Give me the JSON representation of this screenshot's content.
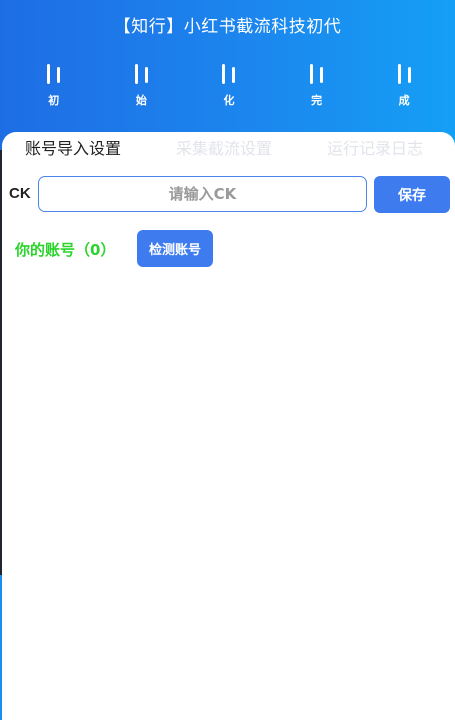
{
  "header": {
    "title": "【知行】小红书截流科技初代",
    "steps": [
      {
        "label": "初",
        "icon": "double-bar-icon"
      },
      {
        "label": "始",
        "icon": "double-bar-icon"
      },
      {
        "label": "化",
        "icon": "double-bar-icon"
      },
      {
        "label": "完",
        "icon": "double-bar-icon"
      },
      {
        "label": "成",
        "icon": "double-bar-icon"
      }
    ]
  },
  "tabs": [
    {
      "label": "账号导入设置",
      "active": true
    },
    {
      "label": "采集截流设置",
      "active": false
    },
    {
      "label": "运行记录日志",
      "active": false
    }
  ],
  "ck": {
    "label": "CK",
    "value": "",
    "placeholder": "请输入CK",
    "save_label": "保存"
  },
  "accounts": {
    "label": "你的账号（0）",
    "check_label": "检测账号"
  },
  "colors": {
    "header_start": "#1e6de4",
    "header_end": "#149ff5",
    "accent": "#3d7bef",
    "account_text": "#2dd42d",
    "inactive_tab": "#e1e4ea"
  }
}
